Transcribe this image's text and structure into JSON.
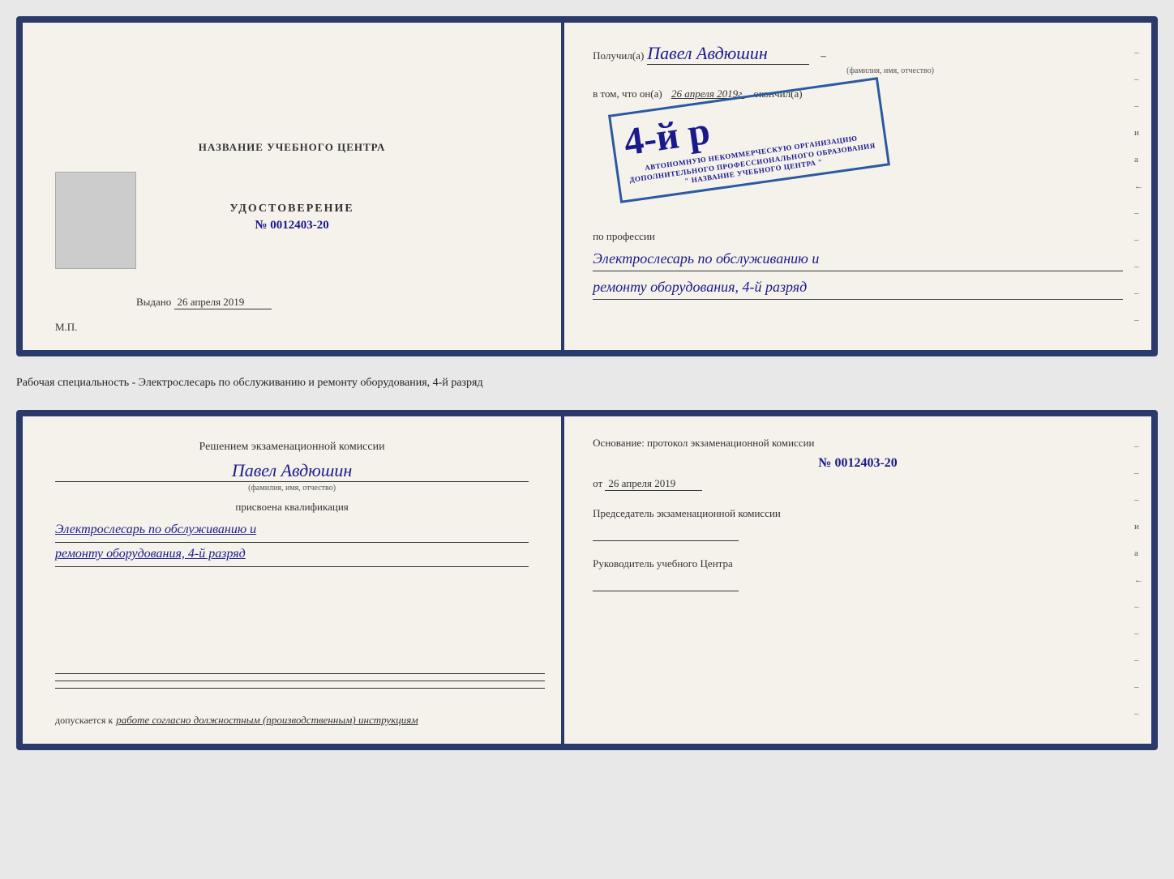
{
  "top_doc": {
    "left": {
      "title": "НАЗВАНИЕ УЧЕБНОГО ЦЕНТРА",
      "cert_label": "УДОСТОВЕРЕНИЕ",
      "cert_number": "№ 0012403-20",
      "vydano_label": "Выдано",
      "vydano_date": "26 апреля 2019",
      "mp_label": "М.П."
    },
    "right": {
      "poluchil_label": "Получил(a)",
      "name_handwritten": "Павел Авдюшин",
      "name_subtitle": "(фамилия, имя, отчество)",
      "vtom_label": "в том, что он(а)",
      "date_handwritten": "26 апреля 2019г.",
      "okonchil_label": "окончил(а)",
      "stamp_large": "4-й р",
      "stamp_line1": "АВТОНОМНУЮ НЕКОММЕРЧЕСКУЮ ОРГАНИЗАЦИЮ",
      "stamp_line2": "ДОПОЛНИТЕЛЬНОГО ПРОФЕССИОНАЛЬНОГО ОБРАЗОВАНИЯ",
      "stamp_line3": "\" НАЗВАНИЕ УЧЕБНОГО ЦЕНТРА \"",
      "profession_label": "по профессии",
      "profession_line1": "Электрослесарь по обслуживанию и",
      "profession_line2": "ремонту оборудования, 4-й разряд"
    }
  },
  "middle_text": "Рабочая специальность - Электрослесарь по обслуживанию и ремонту оборудования, 4-й разряд",
  "bottom_doc": {
    "left": {
      "komissia_title": "Решением экзаменационной  комиссии",
      "name_handwritten": "Павел Авдюшин",
      "name_subtitle": "(фамилия, имя, отчество)",
      "prisvoena_label": "присвоена квалификация",
      "profession_line1": "Электрослесарь по обслуживанию и",
      "profession_line2": "ремонту оборудования, 4-й разряд",
      "dopuskaetsya_label": "допускается к",
      "dopuskaetsya_text": "работе согласно должностным (производственным) инструкциям"
    },
    "right": {
      "osnovaniye_label": "Основание: протокол экзаменационной  комиссии",
      "number": "№  0012403-20",
      "ot_label": "от",
      "ot_date": "26 апреля 2019",
      "chairman_label": "Председатель экзаменационной комиссии",
      "head_label": "Руководитель учебного Центра"
    }
  },
  "margin_dashes": [
    "-",
    "-",
    "-",
    "и",
    "а",
    "←",
    "-",
    "-",
    "-",
    "-",
    "-"
  ],
  "margin_dashes_bottom": [
    "-",
    "-",
    "-",
    "и",
    "а",
    "←",
    "-",
    "-",
    "-",
    "-",
    "-"
  ]
}
